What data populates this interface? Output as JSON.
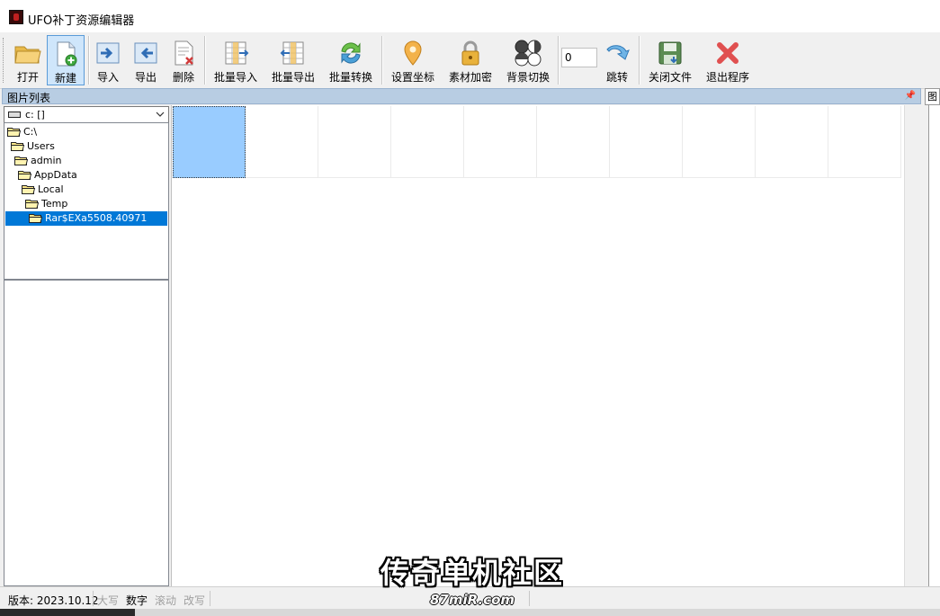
{
  "window": {
    "title": "UFO补丁资源编辑器"
  },
  "toolbar": {
    "buttons": [
      {
        "label": "打开",
        "icon": "folder-open-icon"
      },
      {
        "label": "新建",
        "icon": "new-file-icon"
      },
      {
        "label": "导入",
        "icon": "import-icon"
      },
      {
        "label": "导出",
        "icon": "export-icon"
      },
      {
        "label": "删除",
        "icon": "delete-file-icon"
      },
      {
        "label": "批量导入",
        "icon": "batch-import-icon"
      },
      {
        "label": "批量导出",
        "icon": "batch-export-icon"
      },
      {
        "label": "批量转换",
        "icon": "batch-convert-icon"
      },
      {
        "label": "设置坐标",
        "icon": "location-pin-icon"
      },
      {
        "label": "素材加密",
        "icon": "lock-icon"
      },
      {
        "label": "背景切换",
        "icon": "background-switch-icon"
      },
      {
        "label": "跳转",
        "icon": "jump-arrow-icon"
      },
      {
        "label": "关闭文件",
        "icon": "save-close-icon"
      },
      {
        "label": "退出程序",
        "icon": "exit-x-icon"
      }
    ],
    "jump_value": "0",
    "active_button": "新建"
  },
  "panel": {
    "title": "图片列表",
    "right_tab": "图"
  },
  "drive": {
    "label": "c: []"
  },
  "tree": [
    {
      "label": "C:\\",
      "selected": false
    },
    {
      "label": "Users",
      "selected": false
    },
    {
      "label": "admin",
      "selected": false
    },
    {
      "label": "AppData",
      "selected": false
    },
    {
      "label": "Local",
      "selected": false
    },
    {
      "label": "Temp",
      "selected": false
    },
    {
      "label": "Rar$EXa5508.40971",
      "selected": true
    }
  ],
  "status": {
    "version": "版本: 2023.10.12",
    "caps": "大写",
    "num": "数字",
    "scroll": "滚动",
    "overwrite": "改写"
  },
  "watermark": {
    "line1": "传奇单机社区",
    "line2": "87miR.com"
  },
  "colors": {
    "selection": "#0078d7",
    "selected_cell": "#99ccff",
    "panel_header": "#b8cde3"
  }
}
